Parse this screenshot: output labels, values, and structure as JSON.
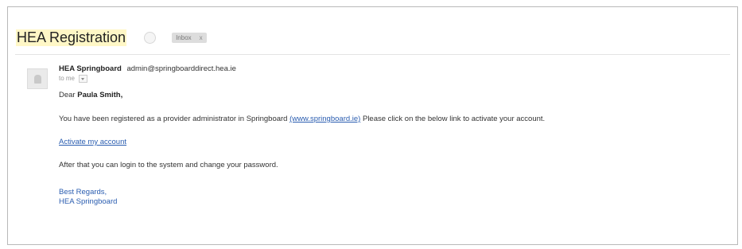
{
  "subject": "HEA Registration",
  "label": {
    "text": "Inbox",
    "close": "x"
  },
  "sender": {
    "name": "HEA Springboard",
    "email": "admin@springboarddirect.hea.ie"
  },
  "to_line": "to me",
  "greeting_prefix": "Dear",
  "greeting_name": "Paula Smith,",
  "body": {
    "line1_before": "You have been registered as a provider administrator in Springboard",
    "line1_link": "(www.springboard.ie)",
    "line1_after": "Please click on the below link to activate your account.",
    "activate_link": "Activate my account",
    "line2": "After that you can login to the system and change your password.",
    "sign1": "Best Regards,",
    "sign2": "HEA Springboard"
  }
}
